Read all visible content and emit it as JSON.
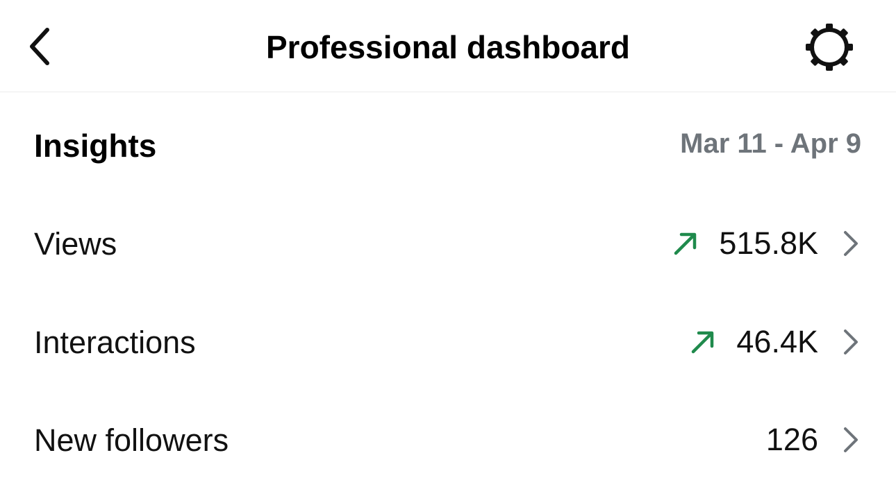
{
  "header": {
    "title": "Professional dashboard",
    "back_icon": "chevron-left-icon",
    "settings_icon": "gear-icon"
  },
  "insights": {
    "title": "Insights",
    "date_range": "Mar 11 - Apr 9"
  },
  "metrics": [
    {
      "label": "Views",
      "value": "515.8K",
      "trend": "up"
    },
    {
      "label": "Interactions",
      "value": "46.4K",
      "trend": "up"
    },
    {
      "label": "New followers",
      "value": "126",
      "trend": "none"
    }
  ],
  "colors": {
    "trend_up": "#1f8a4c",
    "muted_text": "#6e747a",
    "chevron": "#6e747a",
    "divider": "#ececec"
  }
}
